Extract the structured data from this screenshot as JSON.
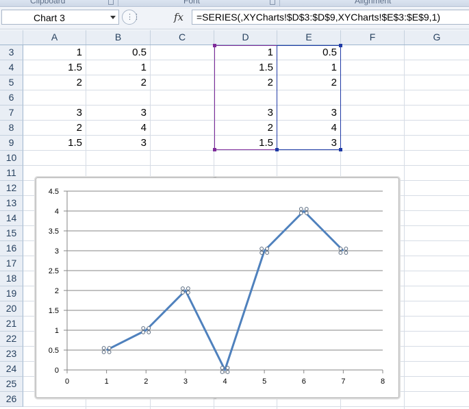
{
  "ribbon": {
    "groups": [
      "Clipboard",
      "Font",
      "Alignment"
    ]
  },
  "formula_bar": {
    "name_box": "Chart 3",
    "fx_label": "fx",
    "formula": "=SERIES(,XYCharts!$D$3:$D$9,XYCharts!$E$3:$E$9,1)"
  },
  "columns": [
    "A",
    "B",
    "C",
    "D",
    "E",
    "F",
    "G"
  ],
  "rows": [
    "3",
    "4",
    "5",
    "6",
    "7",
    "8",
    "9",
    "10",
    "11",
    "12",
    "13",
    "14",
    "15",
    "16",
    "17",
    "18",
    "19",
    "20",
    "21",
    "22",
    "23",
    "24",
    "25",
    "26"
  ],
  "cells": {
    "A": [
      "1",
      "1.5",
      "2",
      "",
      "3",
      "2",
      "1.5"
    ],
    "B": [
      "0.5",
      "1",
      "2",
      "",
      "3",
      "4",
      "3"
    ],
    "D": [
      "1",
      "1.5",
      "2",
      "",
      "3",
      "2",
      "1.5"
    ],
    "E": [
      "0.5",
      "1",
      "2",
      "",
      "3",
      "4",
      "3"
    ]
  },
  "colors": {
    "series_line": "#4f81bd",
    "x_range_highlight": "#7f2a9a",
    "y_range_highlight": "#1f3aa5"
  },
  "chart_data": {
    "type": "line",
    "x": [
      1,
      2,
      3,
      4,
      5,
      6,
      7
    ],
    "series": [
      {
        "values": [
          0.5,
          1,
          2,
          0,
          3,
          4,
          3
        ]
      }
    ],
    "xlim": [
      0,
      8
    ],
    "ylim": [
      0,
      4.5
    ],
    "xticks": [
      "0",
      "1",
      "2",
      "3",
      "4",
      "5",
      "6",
      "7",
      "8"
    ],
    "yticks": [
      "0",
      "0.5",
      "1",
      "1.5",
      "2",
      "2.5",
      "3",
      "3.5",
      "4",
      "4.5"
    ],
    "grid": true,
    "title": "",
    "xlabel": "",
    "ylabel": ""
  }
}
